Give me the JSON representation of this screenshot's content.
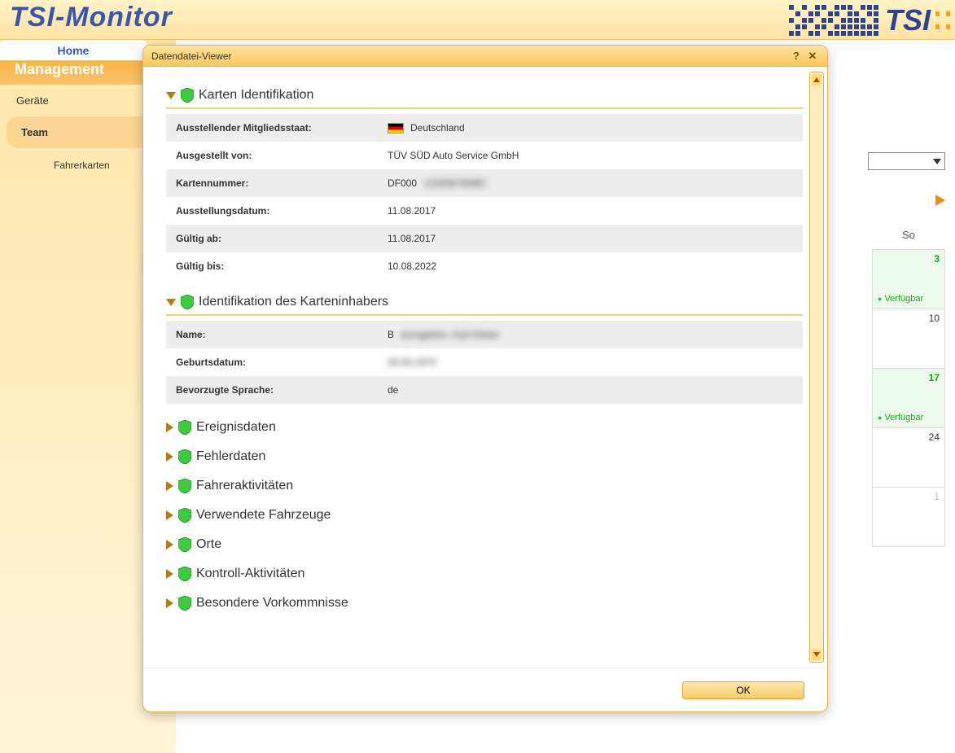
{
  "app": {
    "title": "TSI-Monitor",
    "brand": "TSI"
  },
  "nav": {
    "home": "Home"
  },
  "sidebar": {
    "management_label": "Management",
    "items": [
      {
        "label": "Geräte",
        "active": false
      },
      {
        "label": "Team",
        "active": true
      }
    ],
    "sub": {
      "label": "Fahrerkarten"
    }
  },
  "calendar": {
    "day_header": "So",
    "cells": [
      {
        "num": "3",
        "green": true,
        "status": "Verfügbar"
      },
      {
        "num": "10",
        "green": false
      },
      {
        "num": "17",
        "green": true,
        "status": "Verfügbar"
      },
      {
        "num": "24",
        "green": false
      },
      {
        "num": "1",
        "green": false,
        "dim": true
      }
    ]
  },
  "modal": {
    "title": "Datendatei-Viewer",
    "ok": "OK",
    "sections": {
      "card_id": {
        "title": "Karten Identifikation",
        "rows": [
          {
            "k": "Ausstellender Mitgliedsstaat:",
            "v": "Deutschland",
            "flag": true
          },
          {
            "k": "Ausgestellt von:",
            "v": "TÜV SÜD Auto Service GmbH"
          },
          {
            "k": "Kartennummer:",
            "v": "DF000████████",
            "blur_tail": true
          },
          {
            "k": "Ausstellungsdatum:",
            "v": "11.08.2017"
          },
          {
            "k": "Gültig ab:",
            "v": "11.08.2017"
          },
          {
            "k": "Gültig bis:",
            "v": "10.08.2022"
          }
        ]
      },
      "holder_id": {
        "title": "Identifikation des Karteninhabers",
        "rows": [
          {
            "k": "Name:",
            "v": "B███████, ███ ██████",
            "blur_tail": true
          },
          {
            "k": "Geburtsdatum:",
            "v": "██.██.████",
            "blur_all": true
          },
          {
            "k": "Bevorzugte Sprache:",
            "v": "de"
          }
        ]
      },
      "collapsed": [
        "Ereignisdaten",
        "Fehlerdaten",
        "Fahreraktivitäten",
        "Verwendete Fahrzeuge",
        "Orte",
        "Kontroll-Aktivitäten",
        "Besondere Vorkommnisse"
      ]
    }
  }
}
